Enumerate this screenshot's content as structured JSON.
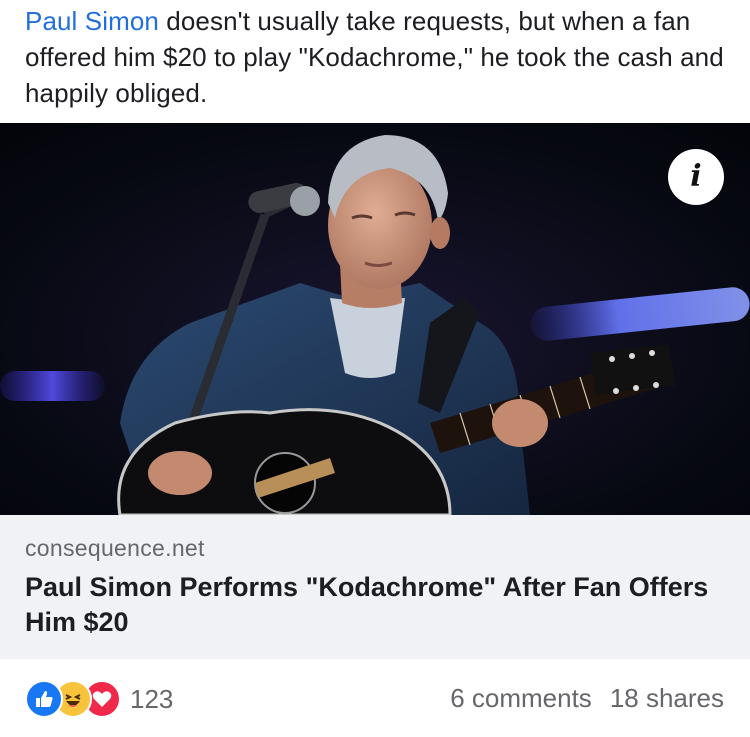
{
  "post": {
    "author_mention": "Paul Simon",
    "text": " doesn't usually take requests, but when a fan offered him $20 to play \"Kodachrome,\" he took the cash and happily obliged."
  },
  "media": {
    "info_icon": "info-icon",
    "info_glyph": "i"
  },
  "link_preview": {
    "domain": "consequence.net",
    "title": "Paul Simon Performs \"Kodachrome\" After Fan Offers Him $20"
  },
  "engagement": {
    "reaction_icons": [
      "like-icon",
      "haha-icon",
      "love-icon"
    ],
    "reaction_count": "123",
    "comments": "6 comments",
    "shares": "18 shares"
  },
  "colors": {
    "mention": "#216fdb",
    "like": "#1877f2",
    "haha": "#f7c43c",
    "love": "#f02849",
    "card_bg": "#f0f2f5",
    "muted": "#65676b"
  }
}
